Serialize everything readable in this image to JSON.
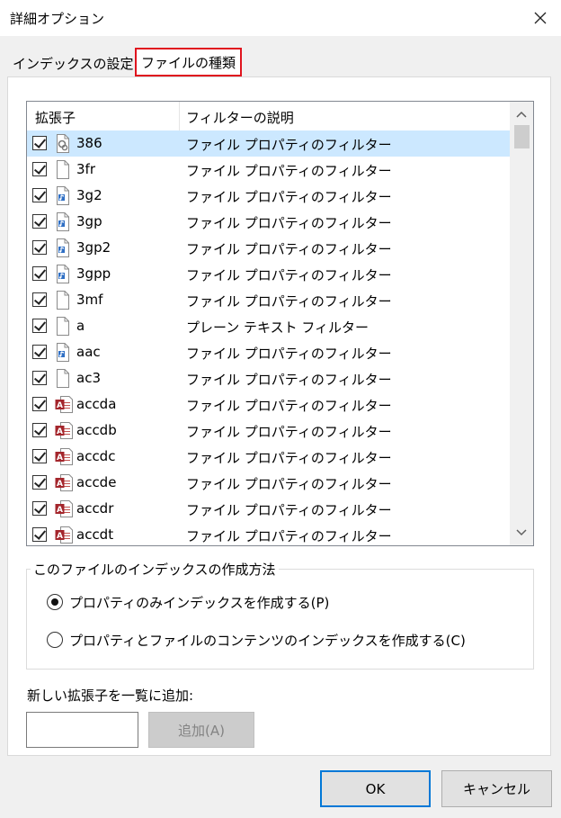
{
  "window": {
    "title": "詳細オプション"
  },
  "tabs": [
    {
      "label": "インデックスの設定",
      "active": false
    },
    {
      "label": "ファイルの種類",
      "active": true
    }
  ],
  "listview": {
    "columns": [
      "拡張子",
      "フィルターの説明"
    ],
    "rows": [
      {
        "ext": "386",
        "desc": "ファイル プロパティのフィルター",
        "icon": "system-file-icon",
        "checked": true,
        "selected": true
      },
      {
        "ext": "3fr",
        "desc": "ファイル プロパティのフィルター",
        "icon": "blank-file-icon",
        "checked": true
      },
      {
        "ext": "3g2",
        "desc": "ファイル プロパティのフィルター",
        "icon": "media-file-icon",
        "checked": true
      },
      {
        "ext": "3gp",
        "desc": "ファイル プロパティのフィルター",
        "icon": "media-file-icon",
        "checked": true
      },
      {
        "ext": "3gp2",
        "desc": "ファイル プロパティのフィルター",
        "icon": "media-file-icon",
        "checked": true
      },
      {
        "ext": "3gpp",
        "desc": "ファイル プロパティのフィルター",
        "icon": "media-file-icon",
        "checked": true
      },
      {
        "ext": "3mf",
        "desc": "ファイル プロパティのフィルター",
        "icon": "blank-file-icon",
        "checked": true
      },
      {
        "ext": "a",
        "desc": "プレーン テキスト フィルター",
        "icon": "blank-file-icon",
        "checked": true
      },
      {
        "ext": "aac",
        "desc": "ファイル プロパティのフィルター",
        "icon": "media-file-icon",
        "checked": true
      },
      {
        "ext": "ac3",
        "desc": "ファイル プロパティのフィルター",
        "icon": "blank-file-icon",
        "checked": true
      },
      {
        "ext": "accda",
        "desc": "ファイル プロパティのフィルター",
        "icon": "access-file-icon",
        "checked": true
      },
      {
        "ext": "accdb",
        "desc": "ファイル プロパティのフィルター",
        "icon": "access-file-icon",
        "checked": true
      },
      {
        "ext": "accdc",
        "desc": "ファイル プロパティのフィルター",
        "icon": "access-file-icon",
        "checked": true
      },
      {
        "ext": "accde",
        "desc": "ファイル プロパティのフィルター",
        "icon": "access-file-icon",
        "checked": true
      },
      {
        "ext": "accdr",
        "desc": "ファイル プロパティのフィルター",
        "icon": "access-file-icon",
        "checked": true
      },
      {
        "ext": "accdt",
        "desc": "ファイル プロパティのフィルター",
        "icon": "access-file-icon",
        "checked": true
      }
    ]
  },
  "index_method": {
    "group_label": "このファイルのインデックスの作成方法",
    "options": [
      {
        "label": "プロパティのみインデックスを作成する(P)",
        "selected": true
      },
      {
        "label": "プロパティとファイルのコンテンツのインデックスを作成する(C)",
        "selected": false
      }
    ]
  },
  "new_extension": {
    "label": "新しい拡張子を一覧に追加:",
    "value": "",
    "add_button": "追加(A)"
  },
  "buttons": {
    "ok": "OK",
    "cancel": "キャンセル"
  },
  "colors": {
    "selected_row": "#cce8ff",
    "active_tab_border": "#e0141e",
    "default_button_border": "#0078d7"
  }
}
